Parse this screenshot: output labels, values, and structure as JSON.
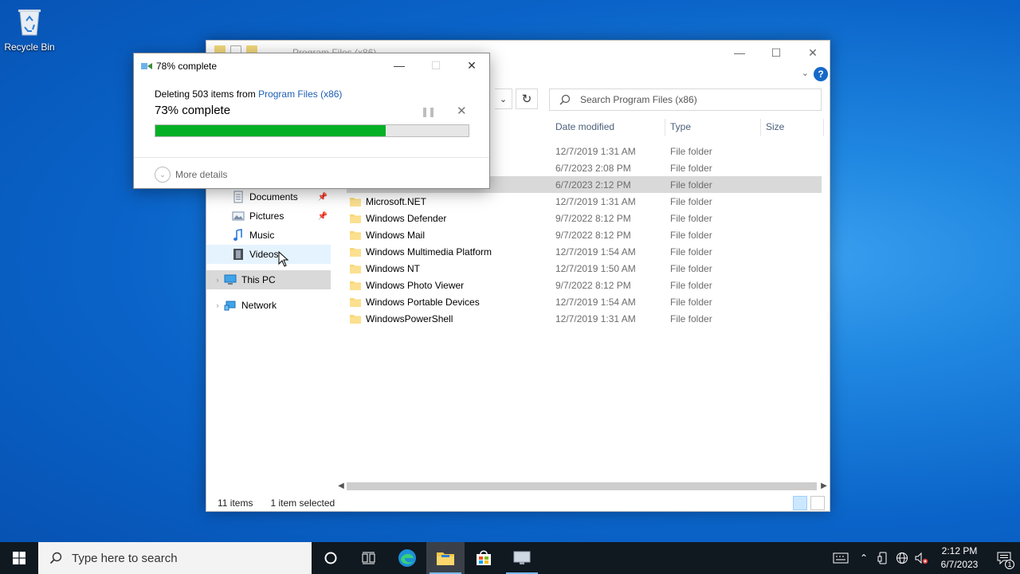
{
  "desktop": {
    "recycle_bin_label": "Recycle Bin"
  },
  "explorer": {
    "title": "Program Files (x86)",
    "search_placeholder": "Search Program Files (x86)",
    "columns": {
      "date": "Date modified",
      "type": "Type",
      "size": "Size"
    },
    "nav": [
      {
        "label": "Documents",
        "icon": "documents-icon",
        "pinned": true
      },
      {
        "label": "Pictures",
        "icon": "pictures-icon",
        "pinned": true
      },
      {
        "label": "Music",
        "icon": "music-icon",
        "pinned": false
      },
      {
        "label": "Videos",
        "icon": "videos-icon",
        "pinned": false
      },
      {
        "label": "This PC",
        "icon": "this-pc-icon",
        "pinned": false
      },
      {
        "label": "Network",
        "icon": "network-icon",
        "pinned": false
      }
    ],
    "rows": [
      {
        "name": "",
        "date": "12/7/2019 1:31 AM",
        "type": "File folder"
      },
      {
        "name": "",
        "date": "6/7/2023 2:08 PM",
        "type": "File folder"
      },
      {
        "name": "",
        "date": "6/7/2023 2:12 PM",
        "type": "File folder",
        "selected": true
      },
      {
        "name": "Microsoft.NET",
        "date": "12/7/2019 1:31 AM",
        "type": "File folder"
      },
      {
        "name": "Windows Defender",
        "date": "9/7/2022 8:12 PM",
        "type": "File folder"
      },
      {
        "name": "Windows Mail",
        "date": "9/7/2022 8:12 PM",
        "type": "File folder"
      },
      {
        "name": "Windows Multimedia Platform",
        "date": "12/7/2019 1:54 AM",
        "type": "File folder"
      },
      {
        "name": "Windows NT",
        "date": "12/7/2019 1:50 AM",
        "type": "File folder"
      },
      {
        "name": "Windows Photo Viewer",
        "date": "9/7/2022 8:12 PM",
        "type": "File folder"
      },
      {
        "name": "Windows Portable Devices",
        "date": "12/7/2019 1:54 AM",
        "type": "File folder"
      },
      {
        "name": "WindowsPowerShell",
        "date": "12/7/2019 1:31 AM",
        "type": "File folder"
      }
    ],
    "status": {
      "items": "11 items",
      "selected": "1 item selected"
    }
  },
  "dialog": {
    "title": "78% complete",
    "line_prefix": "Deleting 503 items from ",
    "line_link": "Program Files (x86)",
    "percent_text": "73% complete",
    "progress": 0.735,
    "more_details": "More details"
  },
  "taskbar": {
    "search_placeholder": "Type here to search",
    "time": "2:12 PM",
    "date": "6/7/2023",
    "notification_count": "1"
  },
  "colors": {
    "progress_fill": "#06b025",
    "link": "#1e5fb4",
    "folder": "#f8d775"
  }
}
